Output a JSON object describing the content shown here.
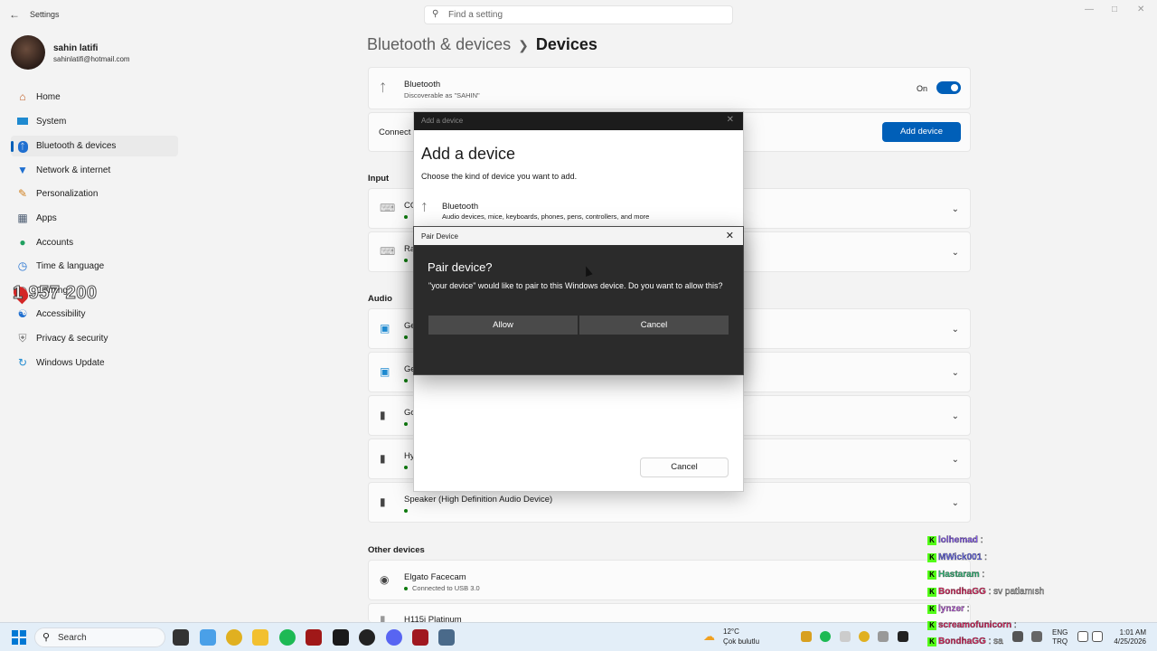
{
  "app": {
    "title": "Settings"
  },
  "search": {
    "placeholder": "Find a setting"
  },
  "profile": {
    "name": "sahin latifi",
    "email": "sahinlatifi@hotmail.com"
  },
  "sidebar": {
    "items": [
      {
        "label": "Home",
        "icon": "home-icon"
      },
      {
        "label": "System",
        "icon": "system-icon"
      },
      {
        "label": "Bluetooth & devices",
        "icon": "bluetooth-icon",
        "active": true
      },
      {
        "label": "Network & internet",
        "icon": "wifi-icon"
      },
      {
        "label": "Personalization",
        "icon": "brush-icon"
      },
      {
        "label": "Apps",
        "icon": "apps-icon"
      },
      {
        "label": "Accounts",
        "icon": "accounts-icon"
      },
      {
        "label": "Time & language",
        "icon": "globe-icon"
      },
      {
        "label": "Gaming",
        "icon": "gaming-icon"
      },
      {
        "label": "Accessibility",
        "icon": "accessibility-icon"
      },
      {
        "label": "Privacy & security",
        "icon": "shield-icon"
      },
      {
        "label": "Windows Update",
        "icon": "update-icon"
      }
    ]
  },
  "overlay": {
    "counter": "1 957 200"
  },
  "breadcrumb": {
    "parent": "Bluetooth & devices",
    "current": "Devices"
  },
  "bluetooth": {
    "title": "Bluetooth",
    "subtitle": "Discoverable as \"SAHIN\"",
    "state": "On"
  },
  "connect": {
    "label": "Connect a",
    "button": "Add device"
  },
  "sections": {
    "input": "Input",
    "audio": "Audio",
    "other": "Other devices"
  },
  "devices": {
    "input": [
      {
        "name": "CO"
      },
      {
        "name": "Ra"
      }
    ],
    "audio": [
      {
        "name": "Ge"
      },
      {
        "name": "Ge"
      },
      {
        "name": "Go"
      },
      {
        "name": "Hy"
      },
      {
        "name": "Speaker (High Definition Audio Device)"
      }
    ],
    "other": [
      {
        "name": "Elgato Facecam",
        "status": "Connected to USB 3.0"
      },
      {
        "name": "H115i Platinum"
      }
    ]
  },
  "add_dialog": {
    "titlebar": "Add a device",
    "heading": "Add a device",
    "subtitle": "Choose the kind of device you want to add.",
    "option_title": "Bluetooth",
    "option_desc": "Audio devices, mice, keyboards, phones, pens, controllers, and more",
    "cancel": "Cancel"
  },
  "pair_dialog": {
    "titlebar": "Pair Device",
    "question": "Pair device?",
    "message": "\"your device\" would like to pair to this Windows device. Do you want to allow this?",
    "allow": "Allow",
    "cancel": "Cancel"
  },
  "chat": [
    {
      "user": "lolhemad",
      "color": "#8a5cf6",
      "msg": ":"
    },
    {
      "user": "MWick001",
      "color": "#6b6bf0",
      "msg": ":"
    },
    {
      "user": "Hastaram",
      "color": "#2fbf7a",
      "msg": ":"
    },
    {
      "user": "BondhaGG",
      "color": "#e0245e",
      "msg": ": sv patlamısh"
    },
    {
      "user": "lynzer",
      "color": "#c060e0",
      "msg": ":"
    },
    {
      "user": "screamofunicorn",
      "color": "#e0245e",
      "msg": ":"
    },
    {
      "user": "BondhaGG",
      "color": "#e0245e",
      "msg": ": sa"
    }
  ],
  "taskbar": {
    "search": "Search",
    "weather_temp": "12°C",
    "weather_desc": "Çok bulutlu",
    "lang1": "ENG",
    "lang2": "TRQ",
    "time": "1:01 AM",
    "date": "4/25/2026"
  }
}
